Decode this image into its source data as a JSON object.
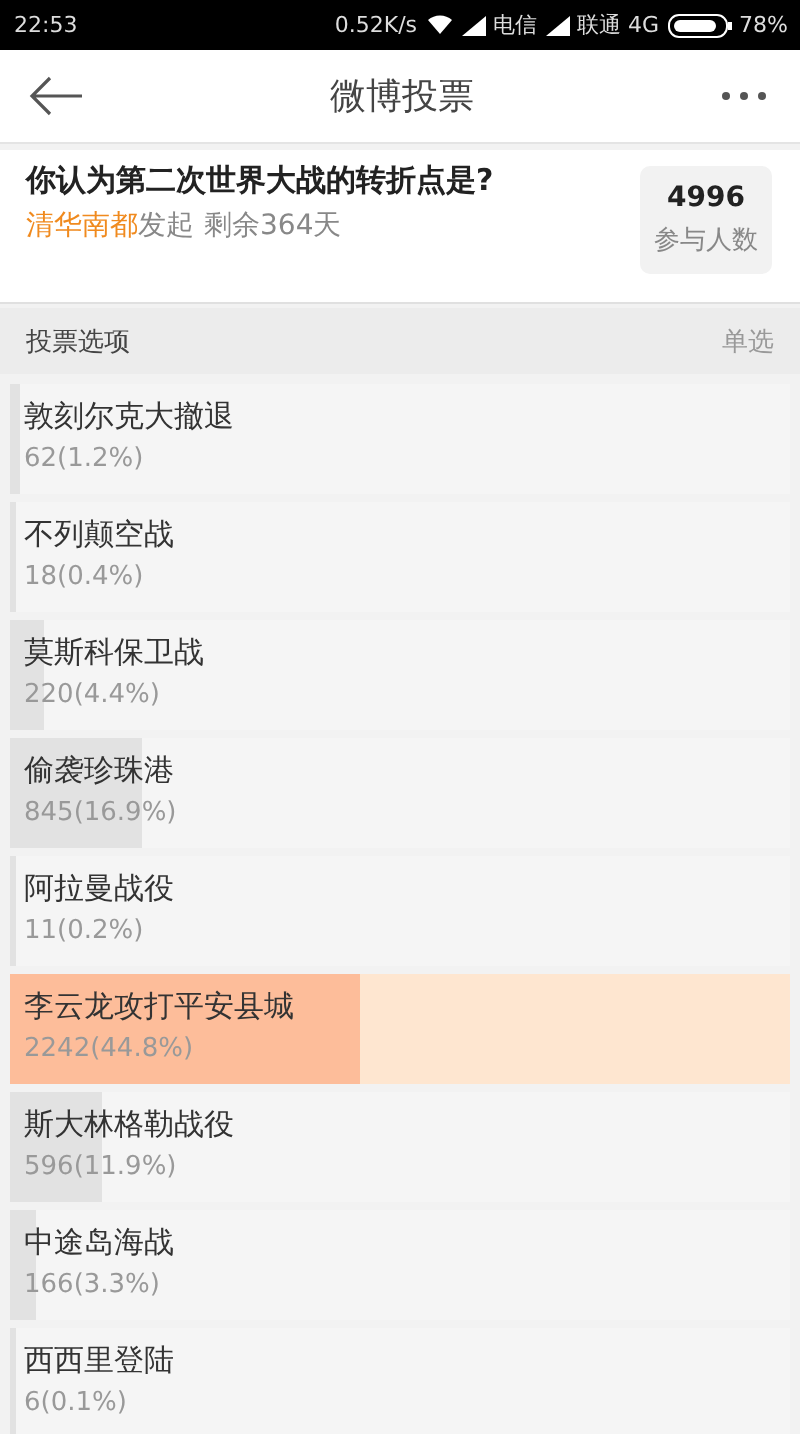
{
  "status_bar": {
    "time": "22:53",
    "speed": "0.52K/s",
    "carrier_1": "电信",
    "carrier_2": "联通 4G",
    "battery": "78%"
  },
  "header": {
    "title": "微博投票"
  },
  "poll": {
    "question": "你认为第二次世界大战的转折点是?",
    "author": "清华南都",
    "started": "发起",
    "remaining": "剩余364天",
    "count": "4996",
    "count_label": "参与人数"
  },
  "section": {
    "title": "投票选项",
    "mode": "单选"
  },
  "options": [
    {
      "label": "敦刻尔克大撤退",
      "result": "62(1.2%)",
      "level": 0.012,
      "selected": false
    },
    {
      "label": "不列颠空战",
      "result": "18(0.4%)",
      "level": 0.004,
      "selected": false
    },
    {
      "label": "莫斯科保卫战",
      "result": "220(4.4%)",
      "level": 0.044,
      "selected": false
    },
    {
      "label": "偷袭珍珠港",
      "result": "845(16.9%)",
      "level": 0.169,
      "selected": false
    },
    {
      "label": "阿拉曼战役",
      "result": "11(0.2%)",
      "level": 0.002,
      "selected": false
    },
    {
      "label": "李云龙攻打平安县城",
      "result": "2242(44.8%)",
      "level": 0.448,
      "selected": true
    },
    {
      "label": "斯大林格勒战役",
      "result": "596(11.9%)",
      "level": 0.119,
      "selected": false
    },
    {
      "label": "中途岛海战",
      "result": "166(3.3%)",
      "level": 0.033,
      "selected": false
    },
    {
      "label": "西西里登陆",
      "result": "6(0.1%)",
      "level": 0.001,
      "selected": false
    }
  ]
}
